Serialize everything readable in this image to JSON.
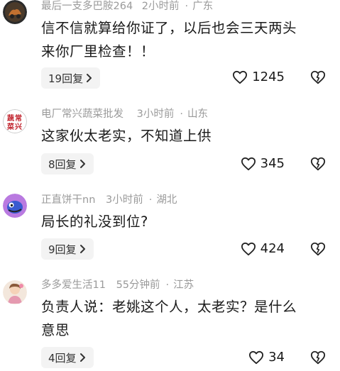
{
  "comments": [
    {
      "author": "最后一支多巴胺264",
      "time": "2小时前",
      "location": "广东",
      "text_line1": "信不信就算给你证了，以后也会三天两头",
      "text_line2": "来你厂里检查！！",
      "reply_label": "19回复",
      "likes": "1245"
    },
    {
      "author": "电厂常兴蔬菜批发",
      "time": "3小时前",
      "location": "山东",
      "text_line1": "这家伙太老实，不知道上供",
      "avatar_chars": "蔬常菜兴",
      "reply_label": "8回复",
      "likes": "345"
    },
    {
      "author": "正直饼干nn",
      "time": "3小时前",
      "location": "湖北",
      "text_line1": "局长的礼没到位?",
      "reply_label": "9回复",
      "likes": "424"
    },
    {
      "author": "多多爱生活11",
      "time": "55分钟前",
      "location": "江苏",
      "text_line1": "负责人说：老姚这个人，太老实？是什么",
      "text_line2": "意思",
      "reply_label": "4回复",
      "likes": "34"
    }
  ],
  "colors": {
    "meta": "#9a9a9a",
    "reply_bg": "#f3f3f3",
    "text": "#1a1a1a"
  },
  "icons": {
    "like": "heart-outline-icon",
    "dislike": "broken-heart-icon",
    "reply": "chevron-right-icon"
  }
}
